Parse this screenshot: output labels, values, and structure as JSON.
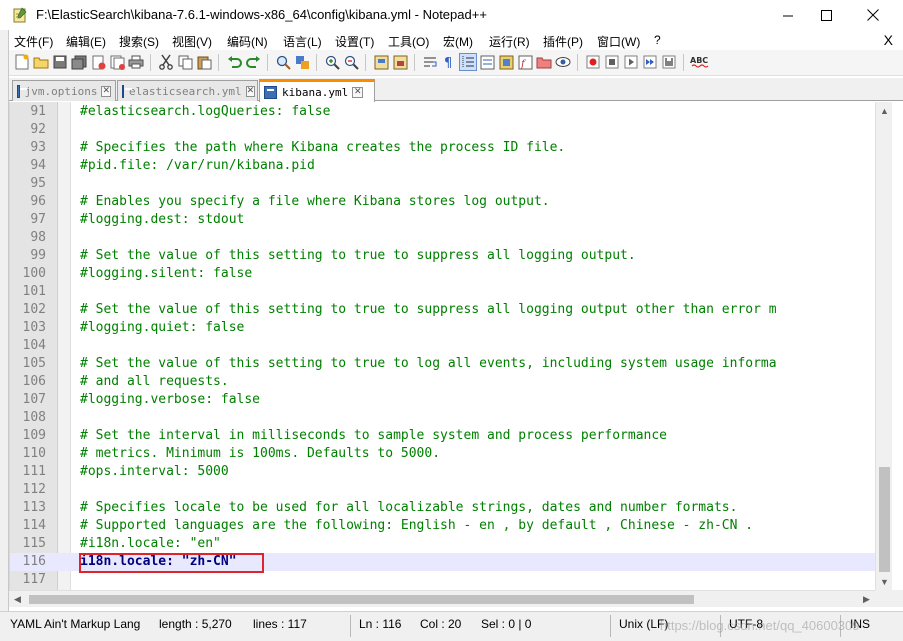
{
  "window": {
    "title": "F:\\ElasticSearch\\kibana-7.6.1-windows-x86_64\\config\\kibana.yml - Notepad++",
    "minimize": "—",
    "maximize": "☐",
    "close": "✕"
  },
  "menu": {
    "items": [
      "文件(F)",
      "编辑(E)",
      "搜索(S)",
      "视图(V)",
      "编码(N)",
      "语言(L)",
      "设置(T)",
      "工具(O)",
      "宏(M)",
      "运行(R)",
      "插件(P)",
      "窗口(W)",
      "?"
    ],
    "close": "X"
  },
  "tabs": [
    {
      "label": "jvm.options",
      "active": false
    },
    {
      "label": "elasticsearch.yml",
      "active": false
    },
    {
      "label": "kibana.yml",
      "active": true
    }
  ],
  "editor": {
    "current_line": 116,
    "highlighted_line": 116,
    "lines": [
      {
        "num": "91",
        "text": "#elasticsearch.logQueries: false"
      },
      {
        "num": "92",
        "text": ""
      },
      {
        "num": "93",
        "text": "# Specifies the path where Kibana creates the process ID file."
      },
      {
        "num": "94",
        "text": "#pid.file: /var/run/kibana.pid"
      },
      {
        "num": "95",
        "text": ""
      },
      {
        "num": "96",
        "text": "# Enables you specify a file where Kibana stores log output."
      },
      {
        "num": "97",
        "text": "#logging.dest: stdout"
      },
      {
        "num": "98",
        "text": ""
      },
      {
        "num": "99",
        "text": "# Set the value of this setting to true to suppress all logging output."
      },
      {
        "num": "100",
        "text": "#logging.silent: false"
      },
      {
        "num": "101",
        "text": ""
      },
      {
        "num": "102",
        "text": "# Set the value of this setting to true to suppress all logging output other than error m"
      },
      {
        "num": "103",
        "text": "#logging.quiet: false"
      },
      {
        "num": "104",
        "text": ""
      },
      {
        "num": "105",
        "text": "# Set the value of this setting to true to log all events, including system usage informa"
      },
      {
        "num": "106",
        "text": "# and all requests."
      },
      {
        "num": "107",
        "text": "#logging.verbose: false"
      },
      {
        "num": "108",
        "text": ""
      },
      {
        "num": "109",
        "text": "# Set the interval in milliseconds to sample system and process performance"
      },
      {
        "num": "110",
        "text": "# metrics. Minimum is 100ms. Defaults to 5000."
      },
      {
        "num": "111",
        "text": "#ops.interval: 5000"
      },
      {
        "num": "112",
        "text": ""
      },
      {
        "num": "113",
        "text": "# Specifies locale to be used for all localizable strings, dates and number formats."
      },
      {
        "num": "114",
        "text": "# Supported languages are the following: English - en , by default , Chinese - zh-CN ."
      },
      {
        "num": "115",
        "text": "#i18n.locale: \"en\""
      },
      {
        "num": "116",
        "text": "i18n.locale: \"zh-CN\""
      },
      {
        "num": "117",
        "text": ""
      }
    ]
  },
  "status": {
    "language": "YAML Ain't Markup Lang",
    "length": "length : 5,270",
    "lines": "lines : 117",
    "ln": "Ln : 116",
    "col": "Col : 20",
    "sel": "Sel : 0 | 0",
    "eol": "Unix (LF)",
    "encoding": "UTF-8",
    "mode": "INS",
    "watermark": "https://blog.csdn.net/qq_40600309"
  },
  "colors": {
    "comment": "#008000",
    "active_tab_accent": "#fa8c00",
    "current_line_bg": "#e8e8ff",
    "highlight_box": "#e0242b"
  }
}
